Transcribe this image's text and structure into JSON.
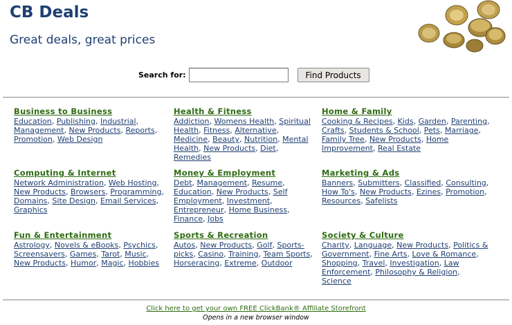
{
  "header": {
    "title": "CB Deals",
    "tagline": "Great deals, great prices"
  },
  "search": {
    "label": "Search for:",
    "value": "",
    "button_label": "Find Products"
  },
  "categories": [
    {
      "title": "Business to Business",
      "links": [
        "Education",
        "Publishing",
        "Industrial",
        "Management",
        "New Products",
        "Reports",
        "Promotion",
        "Web Design"
      ]
    },
    {
      "title": "Health & Fitness",
      "links": [
        "Addiction",
        "Womens Health",
        "Spiritual Health",
        "Fitness",
        "Alternative",
        "Medicine",
        "Beauty",
        "Nutrition",
        "Mental Health",
        "New Products",
        "Diet",
        "Remedies"
      ]
    },
    {
      "title": "Home & Family",
      "links": [
        "Cooking & Recipes",
        "Kids",
        "Garden",
        "Parenting",
        "Crafts",
        "Students & School",
        "Pets",
        "Marriage",
        "Family Tree",
        "New Products",
        "Home Improvement",
        "Real Estate"
      ]
    },
    {
      "title": "Computing & Internet",
      "links": [
        "Network Administration",
        "Web Hosting",
        "New Products",
        "Browsers",
        "Programming",
        "Domains",
        "Site Design",
        "Email Services",
        "Graphics"
      ]
    },
    {
      "title": "Money & Employment",
      "links": [
        "Debt",
        "Management",
        "Resume",
        "Education",
        "New Products",
        "Self Employment",
        "Investment",
        "Entrepreneur",
        "Home Business",
        "Finance",
        "Jobs"
      ]
    },
    {
      "title": "Marketing & Ads",
      "links": [
        "Banners",
        "Submitters",
        "Classified",
        "Consulting",
        "How To's",
        "New Products",
        "Ezines",
        "Promotion",
        "Resources",
        "Safelists"
      ]
    },
    {
      "title": "Fun & Entertainment",
      "links": [
        "Astrology",
        "Novels & eBooks",
        "Psychics",
        "Screensavers",
        "Games",
        "Tarot",
        "Music",
        "New Products",
        "Humor",
        "Magic",
        "Hobbies"
      ]
    },
    {
      "title": "Sports & Recreation",
      "links": [
        "Autos",
        "New Products",
        "Golf",
        "Sports-picks",
        "Casino",
        "Training",
        "Team Sports",
        "Horseracing",
        "Extreme",
        "Outdoor"
      ]
    },
    {
      "title": "Society & Culture",
      "links": [
        "Charity",
        "Language",
        "New Products",
        "Politics & Government",
        "Fine Arts",
        "Love & Romance",
        "Shopping",
        "Travel",
        "Investigation",
        "Law Enforcement",
        "Philosophy & Religion",
        "Science"
      ]
    }
  ],
  "footer": {
    "link_text": "Click here to get your own FREE ClickBank® Affiliate Storefront",
    "note": "Opens in a new browser window"
  }
}
